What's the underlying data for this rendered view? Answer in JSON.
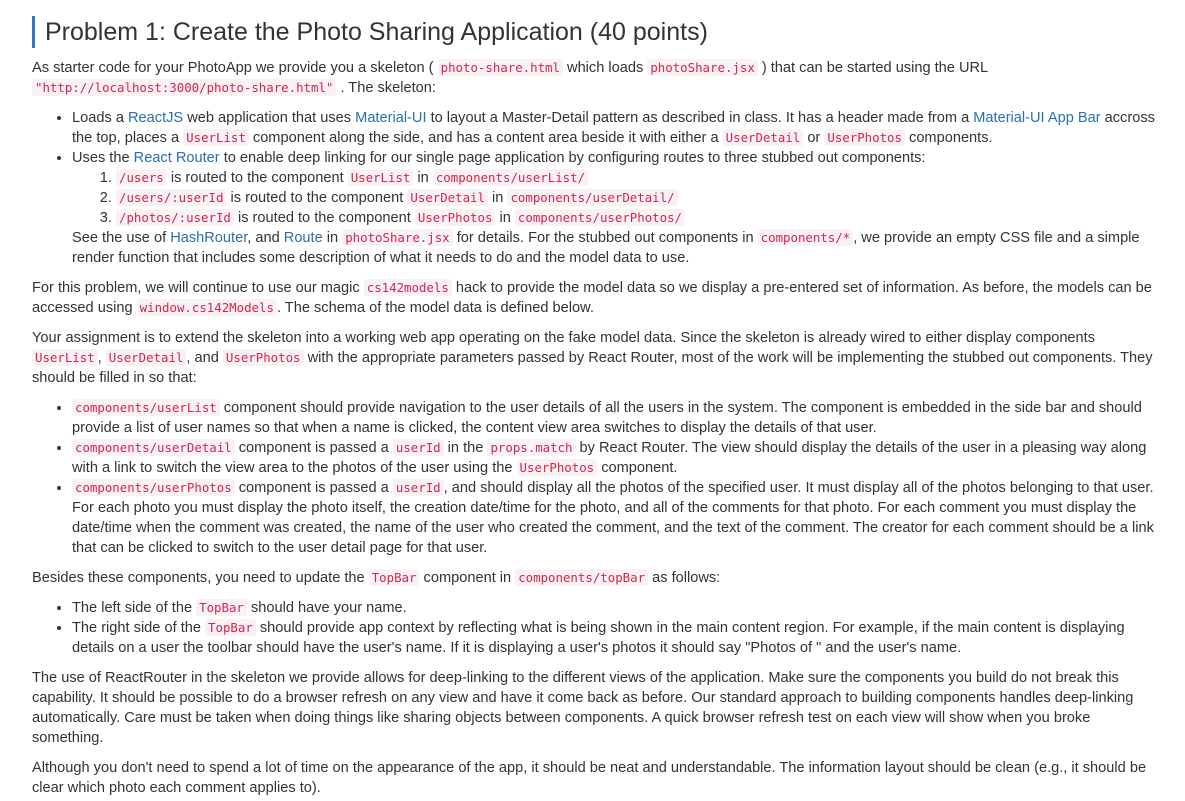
{
  "title": "Problem 1: Create the Photo Sharing Application (40 points)",
  "blocks": [
    {
      "type": "p",
      "segs": [
        {
          "t": "As starter code for your PhotoApp we provide you a skeleton ( "
        },
        {
          "code": "photo-share.html"
        },
        {
          "t": " which loads "
        },
        {
          "code": "photoShare.jsx"
        },
        {
          "t": " ) that can be started using the URL "
        },
        {
          "code": "\"http://localhost:3000/photo-share.html\""
        },
        {
          "t": " . The skeleton:"
        }
      ]
    },
    {
      "type": "ul",
      "items": [
        {
          "segs": [
            {
              "t": "Loads a "
            },
            {
              "link": "ReactJS"
            },
            {
              "t": " web application that uses "
            },
            {
              "link": "Material-UI"
            },
            {
              "t": " to layout a Master-Detail pattern as described in class. It has a header made from a "
            },
            {
              "link": "Material-UI App Bar"
            },
            {
              "t": " accross the top, places a "
            },
            {
              "code": "UserList"
            },
            {
              "t": " component along the side, and has a content area beside it with either a "
            },
            {
              "code": "UserDetail"
            },
            {
              "t": " or "
            },
            {
              "code": "UserPhotos"
            },
            {
              "t": " components."
            }
          ]
        },
        {
          "segs": [
            {
              "t": "Uses the "
            },
            {
              "link": "React Router"
            },
            {
              "t": " to enable deep linking for our single page application by configuring routes to three stubbed out components:"
            }
          ],
          "sub": [
            {
              "segs": [
                {
                  "code": "/users"
                },
                {
                  "t": " is routed to the component "
                },
                {
                  "code": "UserList"
                },
                {
                  "t": " in "
                },
                {
                  "code": "components/userList/"
                }
              ]
            },
            {
              "segs": [
                {
                  "code": "/users/:userId"
                },
                {
                  "t": " is routed to the component "
                },
                {
                  "code": "UserDetail"
                },
                {
                  "t": " in "
                },
                {
                  "code": "components/userDetail/"
                }
              ]
            },
            {
              "segs": [
                {
                  "code": "/photos/:userId"
                },
                {
                  "t": " is routed to the component "
                },
                {
                  "code": "UserPhotos"
                },
                {
                  "t": " in "
                },
                {
                  "code": "components/userPhotos/"
                }
              ]
            }
          ],
          "after": [
            {
              "t": "See the use of "
            },
            {
              "link": "HashRouter"
            },
            {
              "t": ", and "
            },
            {
              "link": "Route"
            },
            {
              "t": " in "
            },
            {
              "code": "photoShare.jsx"
            },
            {
              "t": " for details. For the stubbed out components in "
            },
            {
              "code": "components/*"
            },
            {
              "t": ", we provide an empty CSS file and a simple render function that includes some description of what it needs to do and the model data to use."
            }
          ]
        }
      ]
    },
    {
      "type": "p",
      "segs": [
        {
          "t": "For this problem, we will continue to use our magic "
        },
        {
          "code": "cs142models"
        },
        {
          "t": " hack to provide the model data so we display a pre-entered set of information. As before, the models can be accessed using "
        },
        {
          "code": "window.cs142Models"
        },
        {
          "t": ". The schema of the model data is defined below."
        }
      ]
    },
    {
      "type": "p",
      "segs": [
        {
          "t": "Your assignment is to extend the skeleton into a working web app operating on the fake model data. Since the skeleton is already wired to either display components "
        },
        {
          "code": "UserList"
        },
        {
          "t": ", "
        },
        {
          "code": "UserDetail"
        },
        {
          "t": ", and "
        },
        {
          "code": "UserPhotos"
        },
        {
          "t": " with the appropriate parameters passed by React Router, most of the work will be implementing the stubbed out components. They should be filled in so that:"
        }
      ]
    },
    {
      "type": "ul",
      "items": [
        {
          "segs": [
            {
              "code": "components/userList"
            },
            {
              "t": " component should provide navigation to the user details of all the users in the system. The component is embedded in the side bar and should provide a list of user names so that when a name is clicked, the content view area switches to display the details of that user."
            }
          ]
        },
        {
          "segs": [
            {
              "code": "components/userDetail"
            },
            {
              "t": " component is passed a "
            },
            {
              "code": "userId"
            },
            {
              "t": " in the "
            },
            {
              "code": "props.match"
            },
            {
              "t": " by React Router. The view should display the details of the user in a pleasing way along with a link to switch the view area to the photos of the user using the "
            },
            {
              "code": "UserPhotos"
            },
            {
              "t": " component."
            }
          ]
        },
        {
          "segs": [
            {
              "code": "components/userPhotos"
            },
            {
              "t": " component is passed a "
            },
            {
              "code": "userId"
            },
            {
              "t": ", and should display all the photos of the specified user. It must display all of the photos belonging to that user. For each photo you must display the photo itself, the creation date/time for the photo, and all of the comments for that photo. For each comment you must display the date/time when the comment was created, the name of the user who created the comment, and the text of the comment. The creator for each comment should be a link that can be clicked to switch to the user detail page for that user."
            }
          ]
        }
      ]
    },
    {
      "type": "p",
      "segs": [
        {
          "t": "Besides these components, you need to update the "
        },
        {
          "code": "TopBar"
        },
        {
          "t": " component in "
        },
        {
          "code": "components/topBar"
        },
        {
          "t": " as follows:"
        }
      ]
    },
    {
      "type": "ul",
      "items": [
        {
          "segs": [
            {
              "t": "The left side of the "
            },
            {
              "code": "TopBar"
            },
            {
              "t": " should have your name."
            }
          ]
        },
        {
          "segs": [
            {
              "t": "The right side of the "
            },
            {
              "code": "TopBar"
            },
            {
              "t": " should provide app context by reflecting what is being shown in the main content region. For example, if the main content is displaying details on a user the toolbar should have the user's name. If it is displaying a user's photos it should say \"Photos of \" and the user's name."
            }
          ]
        }
      ]
    },
    {
      "type": "p",
      "segs": [
        {
          "t": "The use of ReactRouter in the skeleton we provide allows for deep-linking to the different views of the application. Make sure the components you build do not break this capability. It should be possible to do a browser refresh on any view and have it come back as before. Our standard approach to building components handles deep-linking automatically. Care must be taken when doing things like sharing objects between components. A quick browser refresh test on each view will show when you broke something."
        }
      ]
    },
    {
      "type": "p",
      "segs": [
        {
          "t": "Although you don't need to spend a lot of time on the appearance of the app, it should be neat and understandable. The information layout should be clean (e.g., it should be clear which photo each comment applies to)."
        }
      ]
    }
  ],
  "colors": {
    "accent": "#2f7bbf",
    "link": "#2a6fb0",
    "code_text": "#d6244d",
    "code_bg": "#f9f2f4"
  }
}
